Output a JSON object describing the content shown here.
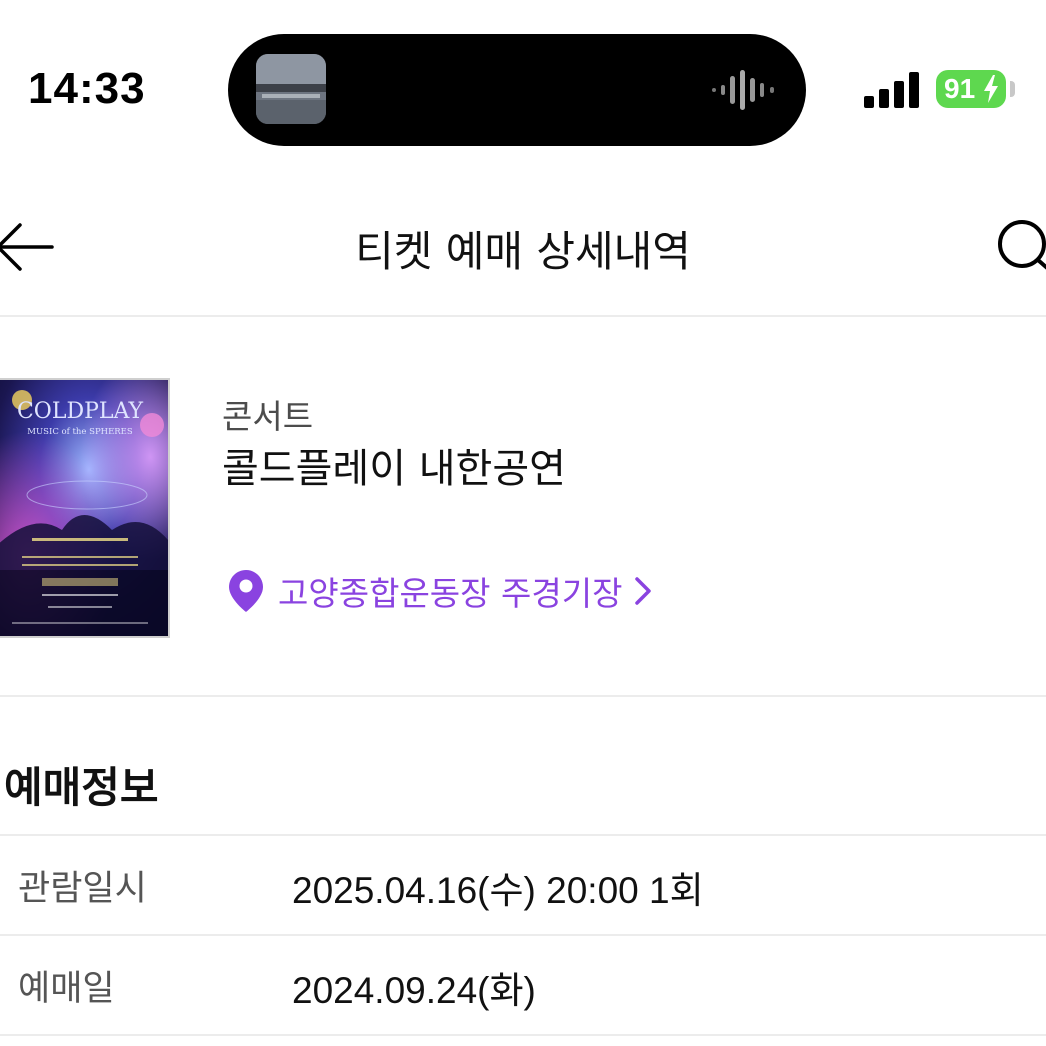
{
  "status_bar": {
    "time": "14:33",
    "battery": "91",
    "battery_color": "#5ed84f",
    "icons": [
      "album-art-icon",
      "audio-waveform-icon",
      "cellular-signal-icon",
      "battery-charging-icon"
    ]
  },
  "nav": {
    "title": "티켓 예매 상세내역",
    "icons": [
      "back-arrow-icon",
      "search-icon"
    ]
  },
  "event": {
    "poster": {
      "band": "COLDPLAY",
      "subtitle": "MUSIC of the SPHERES"
    },
    "category": "콘서트",
    "title": "콜드플레이 내한공연",
    "venue": "고양종합운동장 주경기장",
    "accent_color": "#8a43e0"
  },
  "booking": {
    "section_title": "예매정보",
    "rows": [
      {
        "label": "관람일시",
        "value": "2025.04.16(수) 20:00 1회"
      },
      {
        "label": "예매일",
        "value": "2024.09.24(화)"
      }
    ]
  }
}
